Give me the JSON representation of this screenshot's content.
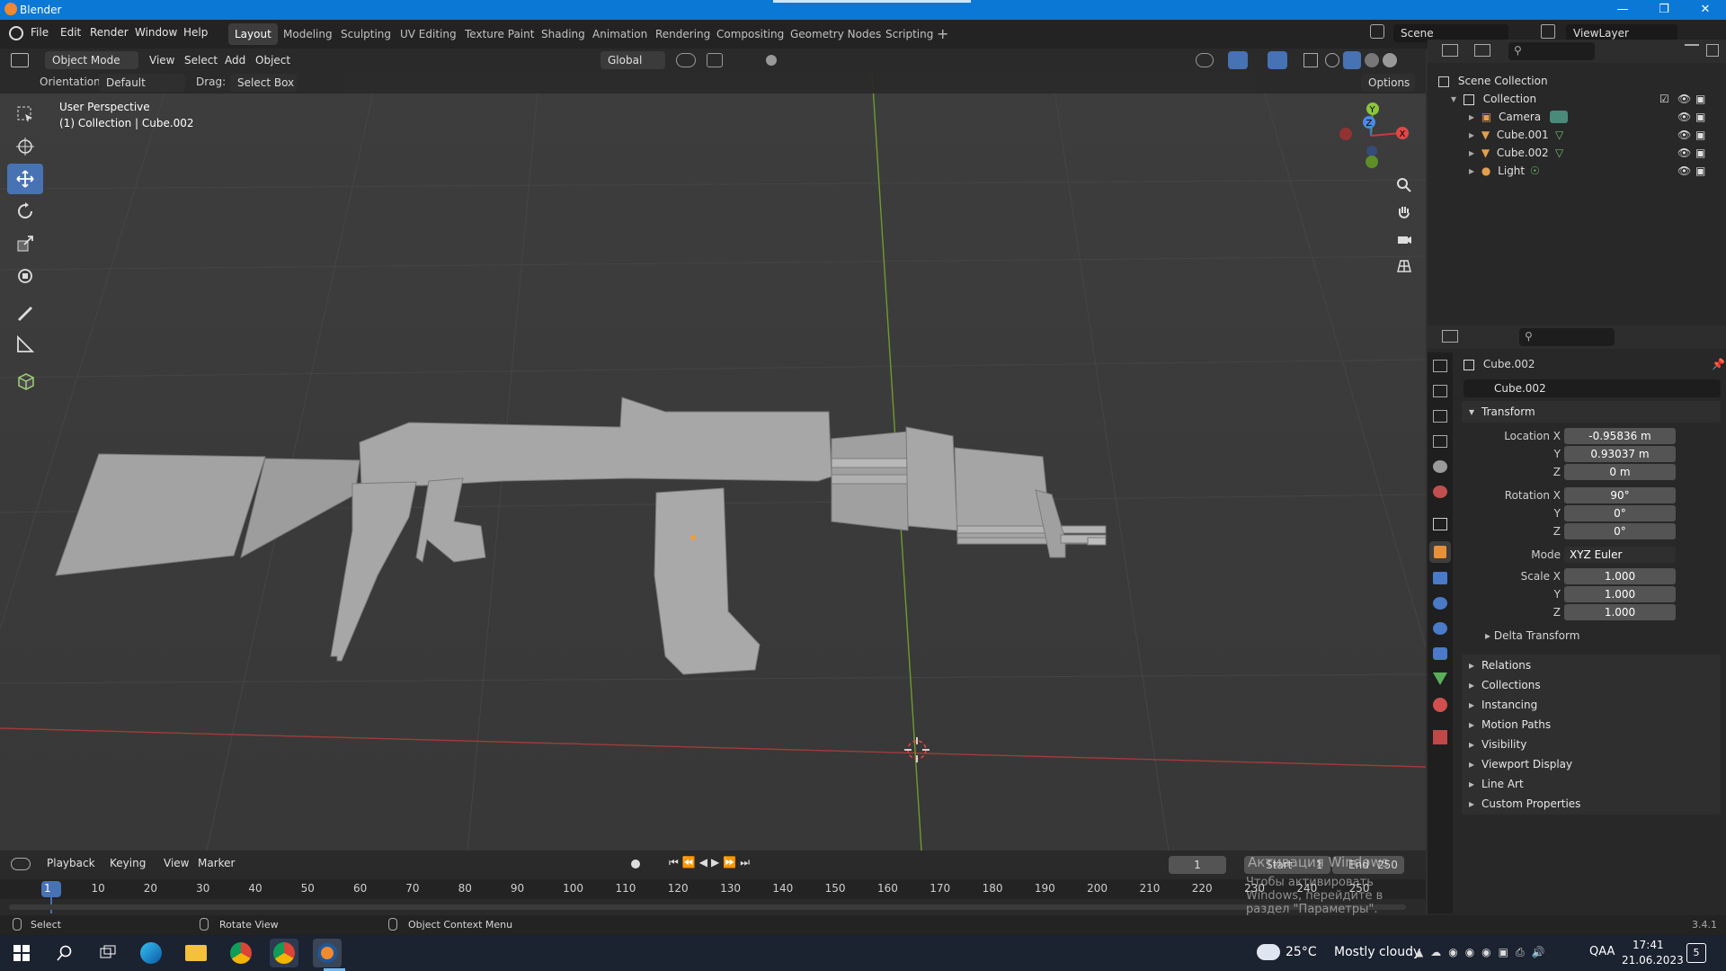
{
  "window": {
    "title": "Blender"
  },
  "menu": [
    "File",
    "Edit",
    "Render",
    "Window",
    "Help"
  ],
  "workspaces": [
    "Layout",
    "Modeling",
    "Sculpting",
    "UV Editing",
    "Texture Paint",
    "Shading",
    "Animation",
    "Rendering",
    "Compositing",
    "Geometry Nodes",
    "Scripting"
  ],
  "active_workspace": "Layout",
  "scene": "Scene",
  "view_layer": "ViewLayer",
  "viewport_header": {
    "mode": "Object Mode",
    "menus": [
      "View",
      "Select",
      "Add",
      "Object"
    ],
    "transform_orientation": "Global",
    "options_label": "Options"
  },
  "tool_settings": {
    "orientation_label": "Orientation:",
    "orientation_value": "Default",
    "drag_label": "Drag:",
    "drag_value": "Select Box"
  },
  "viewport_info": {
    "line1": "User Perspective",
    "line2": "(1) Collection | Cube.002"
  },
  "outliner": {
    "scene_collection": "Scene Collection",
    "collection": "Collection",
    "items": [
      "Camera",
      "Cube.001",
      "Cube.002",
      "Light"
    ]
  },
  "properties": {
    "object_name": "Cube.002",
    "data_name": "Cube.002",
    "transform_header": "Transform",
    "location_label": "Location X",
    "location": [
      "-0.95836 m",
      "0.93037 m",
      "0 m"
    ],
    "rotation_label": "Rotation X",
    "rotation": [
      "90°",
      "0°",
      "0°"
    ],
    "mode_label": "Mode",
    "mode_value": "XYZ Euler",
    "scale_label": "Scale X",
    "scale": [
      "1.000",
      "1.000",
      "1.000"
    ],
    "axis_y": "Y",
    "axis_z": "Z",
    "delta_transform": "Delta Transform",
    "panels": [
      "Relations",
      "Collections",
      "Instancing",
      "Motion Paths",
      "Visibility",
      "Viewport Display",
      "Line Art",
      "Custom Properties"
    ]
  },
  "timeline": {
    "menus": [
      "Playback",
      "Keying",
      "View",
      "Marker"
    ],
    "current_frame": "1",
    "start_label": "Start",
    "start_value": "1",
    "end_label": "End",
    "end_value": "250",
    "ruler": [
      "1",
      "10",
      "20",
      "30",
      "40",
      "50",
      "60",
      "70",
      "80",
      "90",
      "100",
      "110",
      "120",
      "130",
      "140",
      "150",
      "160",
      "170",
      "180",
      "190",
      "200",
      "210",
      "220",
      "230",
      "240",
      "250"
    ],
    "activation_overlay_1": "Активация Windows",
    "activation_overlay_2": "Чтобы активировать Windows, перейдите в раздел \"Параметры\"."
  },
  "statusbar": {
    "select": "Select",
    "rotate_view": "Rotate View",
    "context_menu": "Object Context Menu",
    "version": "3.4.1"
  },
  "taskbar": {
    "weather_temp": "25°C",
    "weather_text": "Mostly cloudy",
    "lang": "QAA",
    "time": "17:41",
    "date": "21.06.2023",
    "notifications": "5"
  },
  "colors": {
    "accent": "#4772b3",
    "x_axis": "#c83a3a",
    "y_axis": "#6a9e2f",
    "z_axis": "#3a73c8",
    "taskbar": "#1b2230"
  }
}
